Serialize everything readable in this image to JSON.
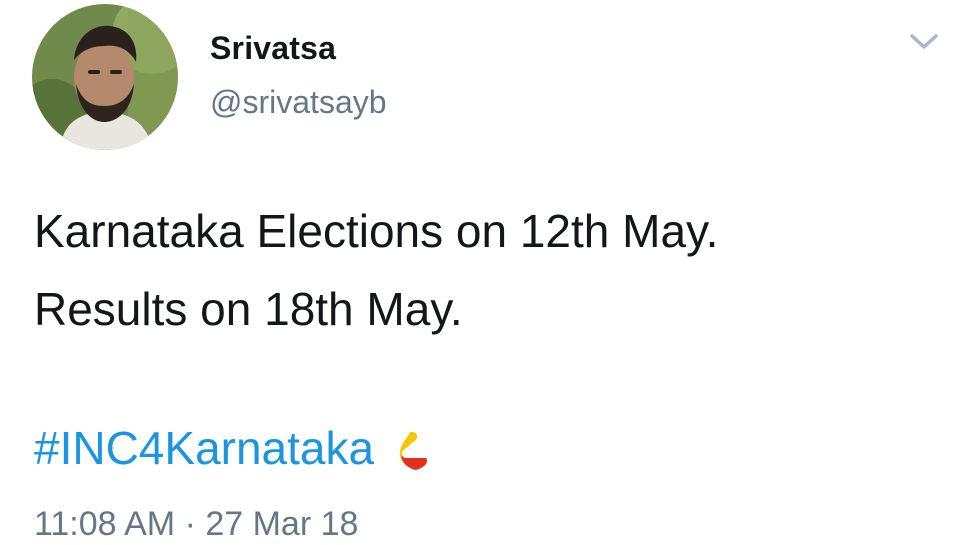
{
  "author": {
    "display_name": "Srivatsa",
    "handle": "@srivatsayb"
  },
  "tweet": {
    "text_lines": [
      "Karnataka Elections on 12th May.",
      "Results on 18th May."
    ],
    "hashtag": "#INC4Karnataka",
    "hashflag_icon": "karnataka-map-flag-icon",
    "timestamp": "11:08 AM · 27 Mar 18"
  },
  "icons": {
    "menu": "chevron-down-icon"
  },
  "colors": {
    "text": "#14171a",
    "secondary": "#657786",
    "link": "#1b95e0",
    "flag_yellow": "#f7c600",
    "flag_red": "#e0301e"
  }
}
